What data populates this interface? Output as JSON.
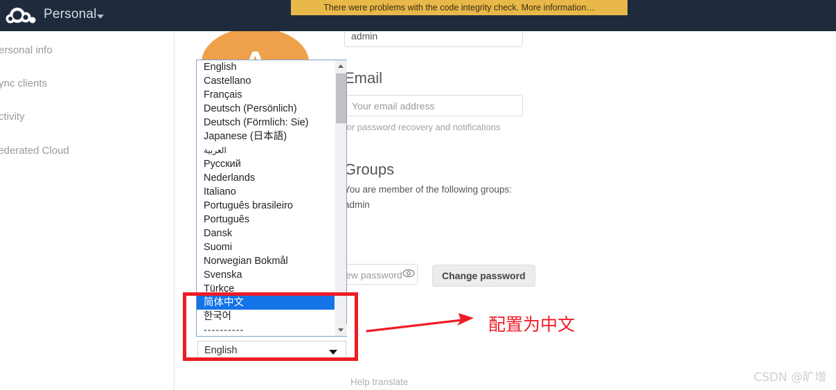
{
  "header": {
    "app_title": "Personal",
    "logo_icon": "owncloud-cloud-logo",
    "caret_icon": "chevron-down-icon",
    "warning": "There were problems with the code integrity check. More information…"
  },
  "sidebar": {
    "items": [
      {
        "label": "Personal info",
        "name": "sidebar-item-personal-info"
      },
      {
        "label": "Sync clients",
        "name": "sidebar-item-sync-clients"
      },
      {
        "label": "Activity",
        "name": "sidebar-item-activity"
      },
      {
        "label": "Federated Cloud",
        "name": "sidebar-item-federated-cloud"
      }
    ]
  },
  "main": {
    "avatar_letter": "A",
    "username_value": "admin",
    "email": {
      "title": "Email",
      "placeholder": "Your email address",
      "hint": "for password recovery and notifications"
    },
    "groups": {
      "title": "Groups",
      "description": "You are member of the following groups:",
      "list": "admin"
    },
    "password": {
      "new_password_placeholder": "New password",
      "show_password_icon": "eye-icon",
      "change_button": "Change password"
    },
    "language": {
      "selected": "English",
      "help_translate": "Help translate",
      "dropdown_arrow_icon": "chevron-down-icon",
      "options": [
        "English",
        "Castellano",
        "Français",
        "Deutsch (Persönlich)",
        "Deutsch (Förmlich: Sie)",
        "Japanese (日本語)",
        "العربية",
        "Русский",
        "Nederlands",
        "Italiano",
        "Português brasileiro",
        "Português",
        "Dansk",
        "Suomi",
        "Norwegian Bokmål",
        "Svenska",
        "Türkçe",
        "简体中文",
        "한국어",
        "----------"
      ],
      "highlighted_option": "简体中文",
      "scroll_up_icon": "triangle-up-icon",
      "scroll_down_icon": "triangle-down-icon"
    }
  },
  "annotations": {
    "arrow_label": "配置为中文",
    "highlight_color": "#ee1c25",
    "watermark": "CSDN @旷增"
  },
  "colors": {
    "header_bg": "#1f2a3d",
    "warning_bg": "#e9b84a",
    "avatar_bg": "#efa04b",
    "selection_blue": "#1473e6",
    "annotation_red": "#ee1c25"
  }
}
